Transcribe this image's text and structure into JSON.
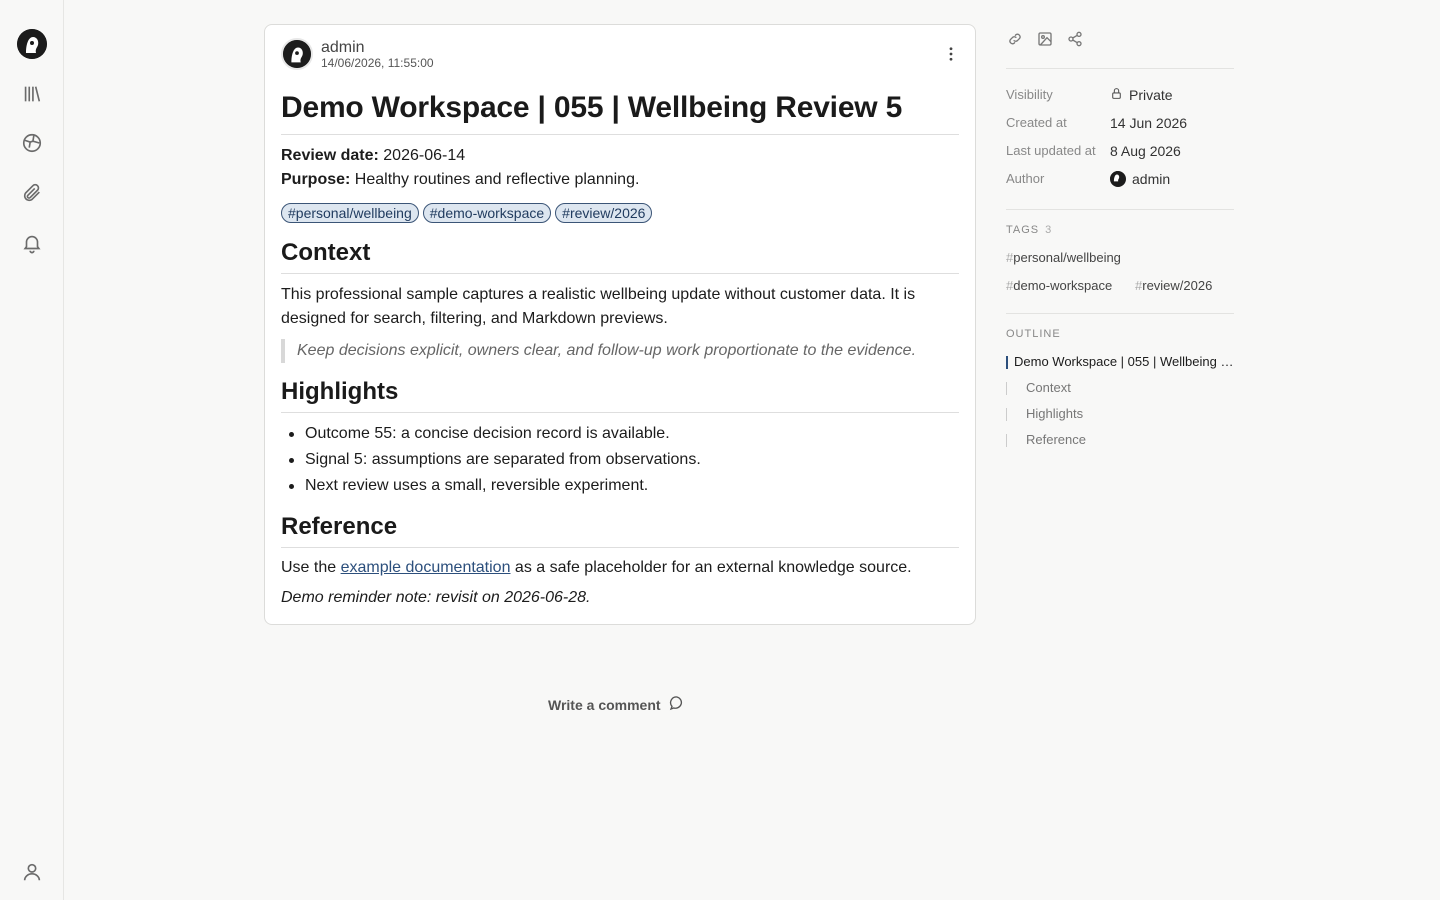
{
  "note": {
    "author": "admin",
    "timestamp": "14/06/2026, 11:55:00",
    "title": "Demo Workspace | 055 | Wellbeing Review 5",
    "review_date_label": "Review date:",
    "review_date": "2026-06-14",
    "purpose_label": "Purpose:",
    "purpose": "Healthy routines and reflective planning.",
    "tags": [
      "#personal/wellbeing",
      "#demo-workspace",
      "#review/2026"
    ],
    "context_heading": "Context",
    "context_line1": "This professional sample captures a realistic wellbeing update without customer data. It is",
    "context_line2": "designed for search, filtering, and Markdown previews.",
    "quote": "Keep decisions explicit, owners clear, and follow-up work proportionate to the evidence.",
    "highlights_heading": "Highlights",
    "highlights": [
      "Outcome 55: a concise decision record is available.",
      "Signal 5: assumptions are separated from observations.",
      "Next review uses a small, reversible experiment."
    ],
    "reference_heading": "Reference",
    "reference_prefix": "Use the ",
    "reference_link": "example documentation",
    "reference_suffix": " as a safe placeholder for an external knowledge source.",
    "reminder": "Demo reminder note: revisit on 2026-06-28."
  },
  "comment": {
    "label": "Write a comment"
  },
  "panel": {
    "visibility_label": "Visibility",
    "visibility_value": "Private",
    "created_label": "Created at",
    "created_value": "14 Jun 2026",
    "updated_label": "Last updated at",
    "updated_value": "8 Aug 2026",
    "author_label": "Author",
    "author_value": "admin",
    "tags_heading": "TAGS",
    "tags_count": "3",
    "tags": [
      "personal/wellbeing",
      "demo-workspace",
      "review/2026"
    ],
    "outline_heading": "OUTLINE",
    "outline": [
      "Demo Workspace | 055 | Wellbeing Review 5",
      "Context",
      "Highlights",
      "Reference"
    ]
  },
  "colors": {
    "accent": "#2c4f7c",
    "tag_bg": "#dde6f0"
  }
}
